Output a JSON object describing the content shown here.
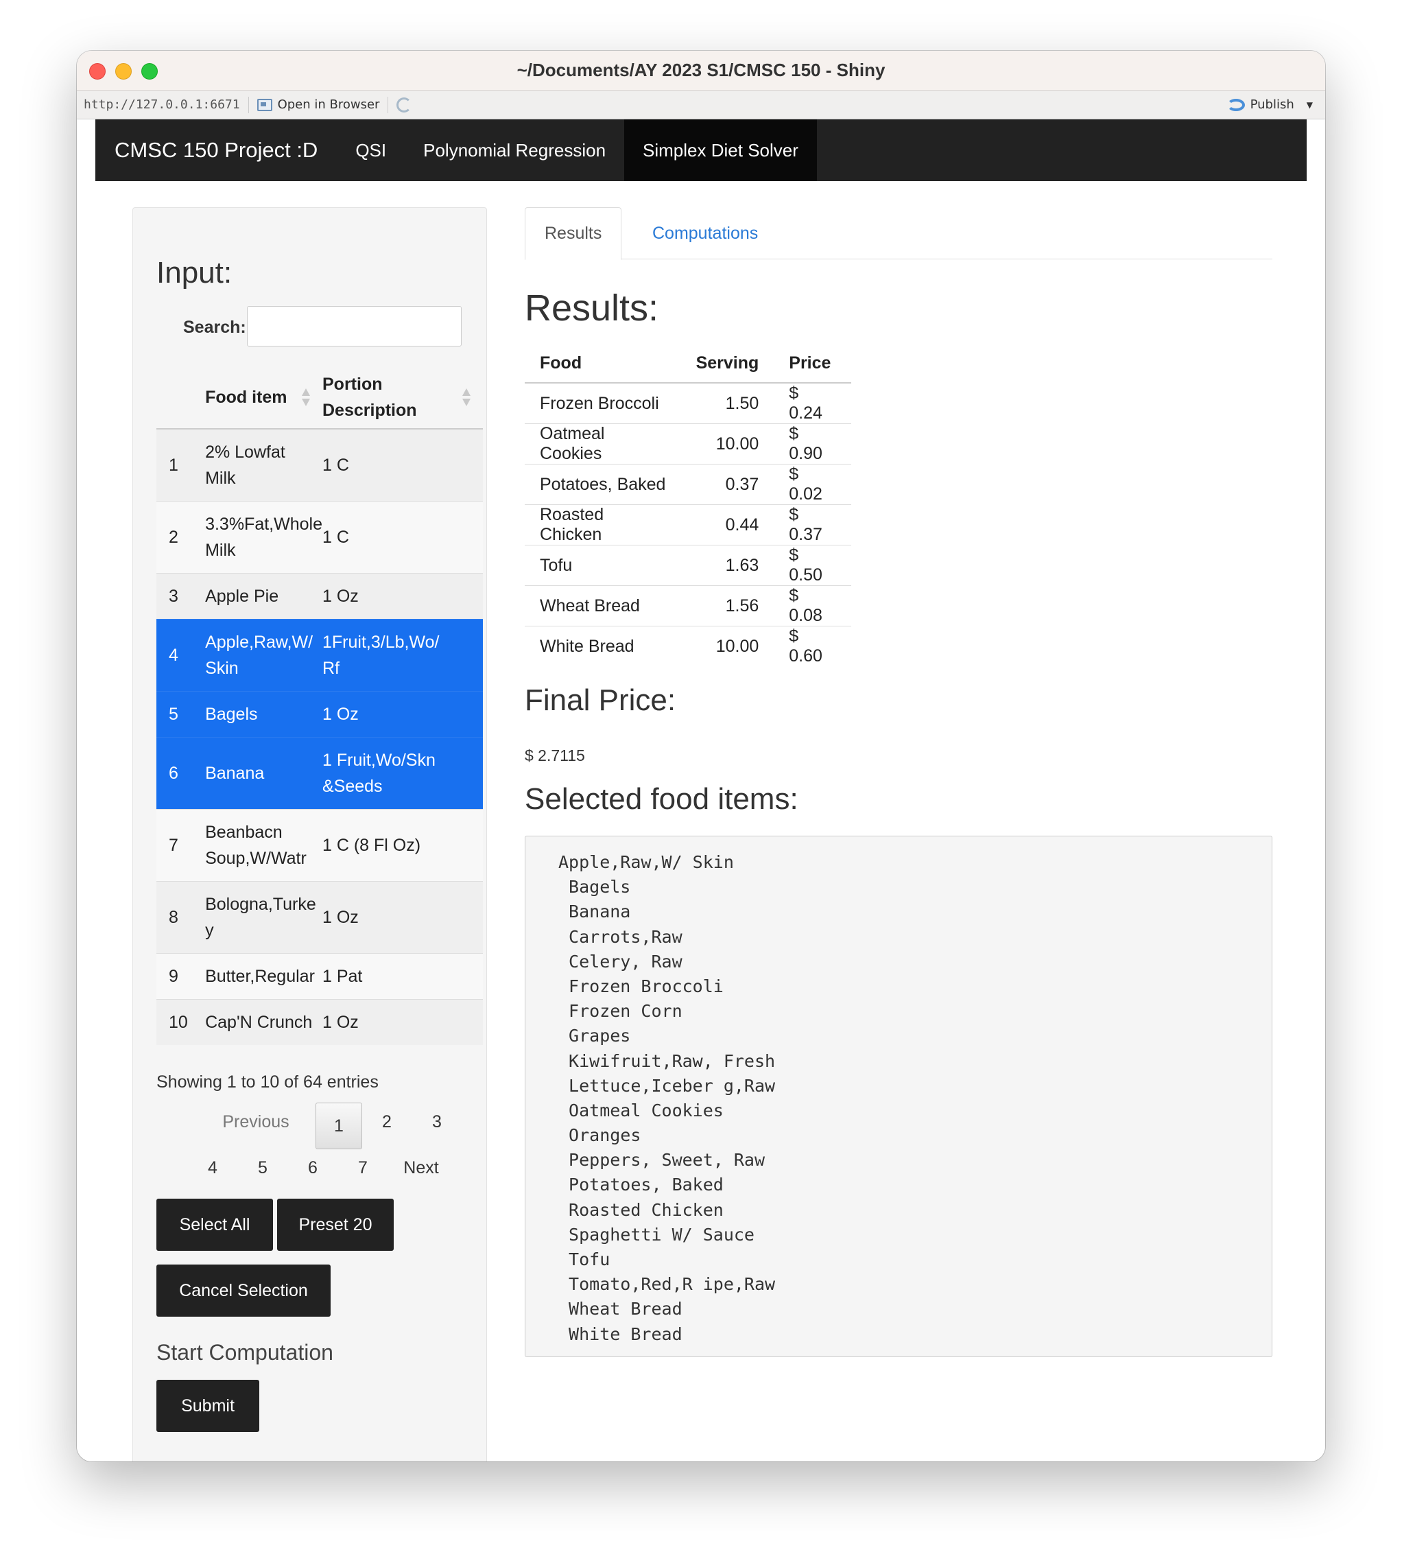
{
  "window": {
    "title": "~/Documents/AY 2023 S1/CMSC 150 - Shiny"
  },
  "addressbar": {
    "url": "http://127.0.0.1:6671",
    "open_in_browser": "Open in Browser",
    "publish": "Publish"
  },
  "navbar": {
    "brand": "CMSC 150 Project :D",
    "items": [
      {
        "label": "QSI"
      },
      {
        "label": "Polynomial Regression"
      },
      {
        "label": "Simplex Diet Solver"
      }
    ]
  },
  "sidebar": {
    "title": "Input:",
    "search_label": "Search:",
    "search_value": "",
    "columns": [
      "Food item",
      "Portion Description"
    ],
    "rows": [
      {
        "num": "1",
        "food_a": "2% Lowfat",
        "food_b": "Milk",
        "portion_a": "1 C",
        "portion_b": ""
      },
      {
        "num": "2",
        "food_a": "3.3%Fat,Whole",
        "food_b": "Milk",
        "portion_a": "1 C",
        "portion_b": ""
      },
      {
        "num": "3",
        "food_a": "Apple Pie",
        "food_b": "",
        "portion_a": "1 Oz",
        "portion_b": ""
      },
      {
        "num": "4",
        "food_a": "Apple,Raw,W/",
        "food_b": "Skin",
        "portion_a": "1Fruit,3/Lb,Wo/",
        "portion_b": "Rf"
      },
      {
        "num": "5",
        "food_a": "Bagels",
        "food_b": "",
        "portion_a": "1 Oz",
        "portion_b": ""
      },
      {
        "num": "6",
        "food_a": "Banana",
        "food_b": "",
        "portion_a": "1 Fruit,Wo/Skn",
        "portion_b": "&Seeds"
      },
      {
        "num": "7",
        "food_a": "Beanbacn",
        "food_b": "Soup,W/Watr",
        "portion_a": "1 C (8 Fl Oz)",
        "portion_b": ""
      },
      {
        "num": "8",
        "food_a": "Bologna,Turke",
        "food_b": "y",
        "portion_a": "1 Oz",
        "portion_b": ""
      },
      {
        "num": "9",
        "food_a": "Butter,Regular",
        "food_b": "",
        "portion_a": "1 Pat",
        "portion_b": ""
      },
      {
        "num": "10",
        "food_a": "Cap'N Crunch",
        "food_b": "",
        "portion_a": "1 Oz",
        "portion_b": ""
      }
    ],
    "info": "Showing 1 to 10 of 64 entries",
    "pagination": {
      "previous": "Previous",
      "next": "Next",
      "pages": [
        "1",
        "2",
        "3",
        "4",
        "5",
        "6",
        "7"
      ]
    },
    "buttons": {
      "select_all": "Select All",
      "preset": "Preset 20",
      "cancel": "Cancel Selection",
      "submit": "Submit"
    },
    "start_label": "Start Computation"
  },
  "main": {
    "tabs": [
      {
        "label": "Results"
      },
      {
        "label": "Computations"
      }
    ],
    "results_heading": "Results:",
    "results_columns": [
      "Food",
      "Serving",
      "Price"
    ],
    "results_rows": [
      {
        "food": "Frozen Broccoli",
        "serving": "1.50",
        "price": "$ 0.24"
      },
      {
        "food": "Oatmeal Cookies",
        "serving": "10.00",
        "price": "$ 0.90"
      },
      {
        "food": "Potatoes, Baked",
        "serving": "0.37",
        "price": "$ 0.02"
      },
      {
        "food": "Roasted Chicken",
        "serving": "0.44",
        "price": "$ 0.37"
      },
      {
        "food": "Tofu",
        "serving": "1.63",
        "price": "$ 0.50"
      },
      {
        "food": "Wheat Bread",
        "serving": "1.56",
        "price": "$ 0.08"
      },
      {
        "food": "White Bread",
        "serving": "10.00",
        "price": "$ 0.60"
      }
    ],
    "final_heading": "Final Price:",
    "final_value": "$ 2.7115",
    "selected_heading": "Selected food items:",
    "selected_items": [
      "Apple,Raw,W/ Skin",
      " Bagels",
      " Banana",
      " Carrots,Raw",
      " Celery, Raw",
      " Frozen Broccoli",
      " Frozen Corn",
      " Grapes",
      " Kiwifruit,Raw, Fresh",
      " Lettuce,Iceber g,Raw",
      " Oatmeal Cookies",
      " Oranges",
      " Peppers, Sweet, Raw",
      " Potatoes, Baked",
      " Roasted Chicken",
      " Spaghetti W/ Sauce",
      " Tofu",
      " Tomato,Red,R ipe,Raw",
      " Wheat Bread",
      " White Bread"
    ]
  }
}
